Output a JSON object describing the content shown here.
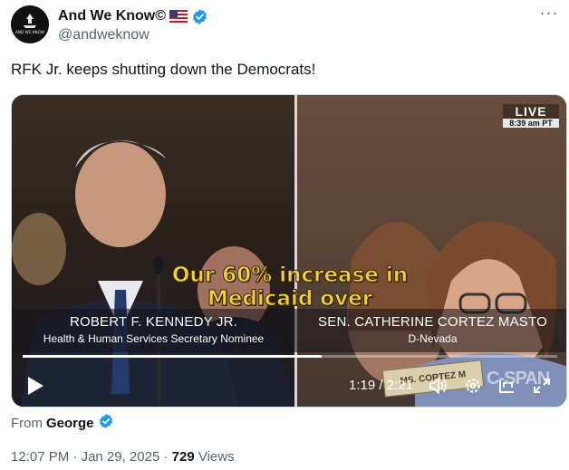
{
  "author": {
    "display_name": "And We Know©",
    "handle": "@andweknow",
    "avatar_text": "AND WE KNOW"
  },
  "tweet": {
    "text": "RFK Jr. keeps shutting down the Democrats!"
  },
  "video": {
    "live_label": "LIVE",
    "live_time": "8:39 am PT",
    "caption_line1": "Our 60% increase in",
    "caption_line2": "Medicaid over",
    "left_chyron_name": "ROBERT F. KENNEDY JR.",
    "left_chyron_title": "Health & Human Services Secretary Nominee",
    "right_chyron_name": "SEN. CATHERINE CORTEZ MASTO",
    "right_chyron_title": "D-Nevada",
    "placard_text": "MS. CORTEZ M",
    "network_logo": "C-SPAN",
    "time_display": "1:19 / 2:21",
    "progress": 0.56
  },
  "attribution": {
    "prefix": "From",
    "user": "George"
  },
  "meta": {
    "time": "12:07 PM",
    "date": "Jan 29, 2025",
    "separator": " · ",
    "views_count": "729",
    "views_label": " Views"
  },
  "colors": {
    "verified": "#1d9bf0",
    "caption": "#f4d03f",
    "secondary_text": "#536471"
  },
  "icons": [
    "verified-badge-icon",
    "us-flag-icon",
    "more-icon",
    "play-icon",
    "volume-icon",
    "settings-icon",
    "captions-icon",
    "fullscreen-icon"
  ]
}
